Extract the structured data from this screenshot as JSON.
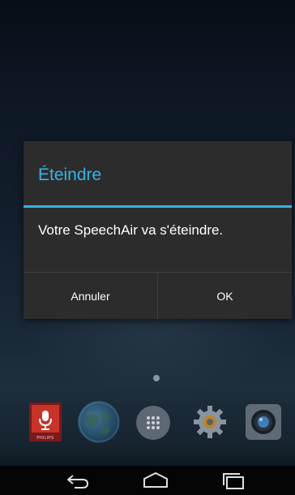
{
  "dialog": {
    "title": "Éteindre",
    "message": "Votre SpeechAir va s'éteindre.",
    "cancel_label": "Annuler",
    "ok_label": "OK"
  },
  "dock": {
    "apps": [
      {
        "name": "speechair-app",
        "icon": "microphone-icon",
        "brand": "PHILIPS"
      },
      {
        "name": "browser-app",
        "icon": "globe-icon"
      },
      {
        "name": "apps-drawer",
        "icon": "grid-dots-icon"
      },
      {
        "name": "settings-app",
        "icon": "gear-icon"
      },
      {
        "name": "camera-app",
        "icon": "camera-icon"
      }
    ]
  },
  "navbar": {
    "buttons": [
      "back-icon",
      "home-icon",
      "recents-icon"
    ]
  },
  "colors": {
    "accent": "#33b5e5",
    "dialog_bg": "#2c2c2c",
    "speechair_red": "#c8342a"
  }
}
